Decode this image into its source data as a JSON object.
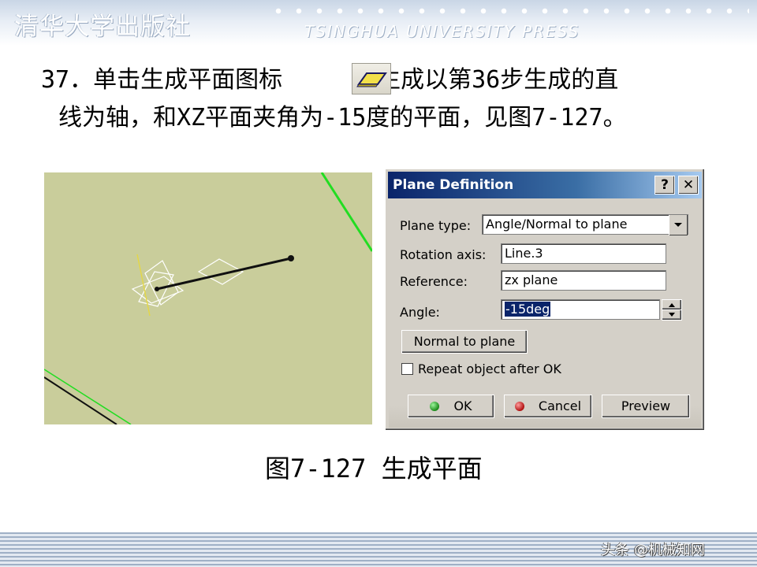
{
  "header": {
    "publisher_cn": "清华大学出版社",
    "publisher_en": "TSINGHUA UNIVERSITY PRESS"
  },
  "instruction": {
    "line1_pre": "37．单击生成平面图标",
    "line1_post": "，生成以第36步生成的直",
    "line2": "线为轴，和XZ平面夹角为-15度的平面，见图7-127。",
    "icon": "plane-icon"
  },
  "dialog": {
    "title": "Plane Definition",
    "help_label": "?",
    "close_label": "✕",
    "plane_type_label": "Plane type:",
    "plane_type_value": "Angle/Normal to plane",
    "rotation_axis_label": "Rotation axis:",
    "rotation_axis_value": "Line.3",
    "reference_label": "Reference:",
    "reference_value": "zx plane",
    "angle_label": "Angle:",
    "angle_value": "-15deg",
    "normal_button": "Normal to plane",
    "repeat_label": "Repeat object after OK",
    "repeat_checked": false,
    "ok_label": "OK",
    "cancel_label": "Cancel",
    "preview_label": "Preview"
  },
  "caption": "图7-127 生成平面",
  "watermark": "头条 @机械知网",
  "colors": {
    "viewport_bg": "#c9cd9b",
    "title_bar": "#0a246a",
    "dialog_bg": "#d4d0c8",
    "edge_green": "#22dd22"
  }
}
